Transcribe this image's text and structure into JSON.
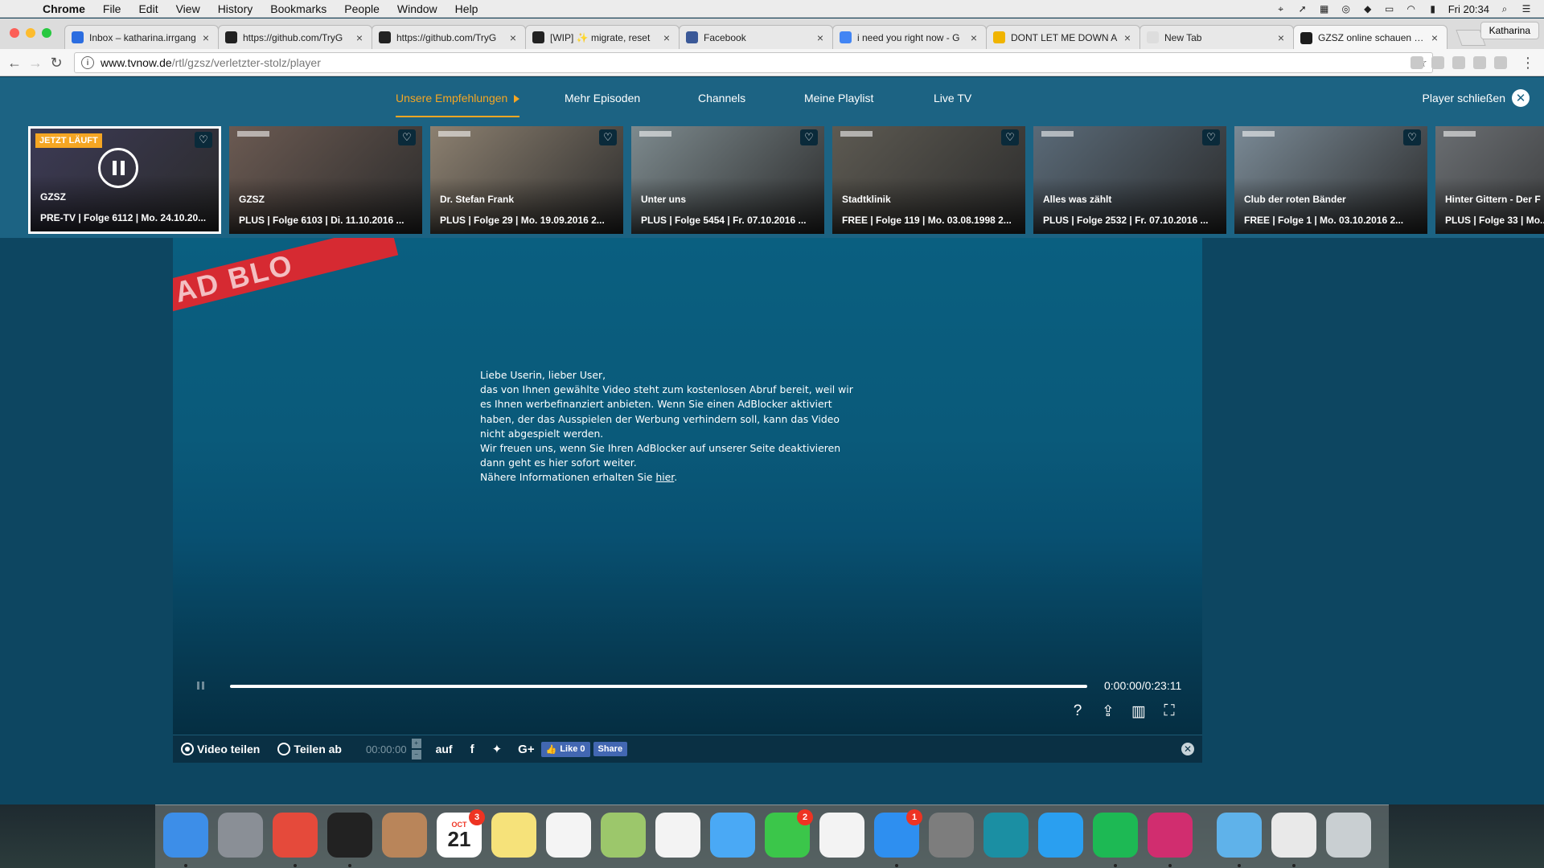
{
  "menubar": {
    "app": "Chrome",
    "items": [
      "File",
      "Edit",
      "View",
      "History",
      "Bookmarks",
      "People",
      "Window",
      "Help"
    ],
    "clock": "Fri 20:34"
  },
  "browser": {
    "tabs": [
      {
        "title": "Inbox – katharina.irrgang",
        "icon": "gmail-icon",
        "color": "#2b6de0"
      },
      {
        "title": "https://github.com/TryG",
        "icon": "github-icon",
        "color": "#222222"
      },
      {
        "title": "https://github.com/TryG",
        "icon": "github-icon",
        "color": "#222222"
      },
      {
        "title": "[WIP] ✨ migrate, reset",
        "icon": "github-icon",
        "color": "#222222"
      },
      {
        "title": "Facebook",
        "icon": "facebook-icon",
        "color": "#3b5998"
      },
      {
        "title": "i need you right now - G",
        "icon": "google-icon",
        "color": "#4285f4"
      },
      {
        "title": "DONT LET ME DOWN A",
        "icon": "extension-icon",
        "color": "#f0b400"
      },
      {
        "title": "New Tab",
        "icon": "",
        "color": "#dddddd"
      },
      {
        "title": "GZSZ online schauen als",
        "icon": "tvnow-icon",
        "color": "#1c1c1c"
      }
    ],
    "active_tab": 8,
    "profile": "Katharina",
    "url_host": "www.tvnow.de",
    "url_path": "/rtl/gzsz/verletzter-stolz/player"
  },
  "tvnav": {
    "items": [
      "Unsere Empfehlungen",
      "Mehr Episoden",
      "Channels",
      "Meine Playlist",
      "Live TV"
    ],
    "close_label": "Player schließen"
  },
  "carousel": {
    "now_playing_badge": "JETZT LÄUFT",
    "cards": [
      {
        "title": "GZSZ",
        "subtitle": "PRE-TV | Folge 6112 | Mo. 24.10.20...",
        "bg": "#3c3a55"
      },
      {
        "title": "GZSZ",
        "subtitle": "PLUS | Folge 6103 | Di. 11.10.2016 ...",
        "bg": "#6b5a52"
      },
      {
        "title": "Dr. Stefan Frank",
        "subtitle": "PLUS | Folge 29 | Mo. 19.09.2016 2...",
        "bg": "#8c8070"
      },
      {
        "title": "Unter uns",
        "subtitle": "PLUS | Folge 5454 | Fr. 07.10.2016 ...",
        "bg": "#7d8a8e"
      },
      {
        "title": "Stadtklinik",
        "subtitle": "FREE | Folge 119 | Mo. 03.08.1998 2...",
        "bg": "#5d5a52"
      },
      {
        "title": "Alles was zählt",
        "subtitle": "PLUS | Folge 2532 | Fr. 07.10.2016 ...",
        "bg": "#5a6a78"
      },
      {
        "title": "Club der roten Bänder",
        "subtitle": "FREE | Folge 1 | Mo. 03.10.2016 2...",
        "bg": "#7a8a96"
      },
      {
        "title": "Hinter Gittern - Der F",
        "subtitle": "PLUS | Folge 33 | Mo...",
        "bg": "#6a6e72"
      }
    ]
  },
  "player": {
    "ribbon_text": "AD BLO",
    "message": {
      "line1": "Liebe Userin, lieber User,",
      "line2": "das von Ihnen gewählte Video steht zum kostenlosen Abruf bereit, weil wir",
      "line3": "es Ihnen werbefinanziert anbieten. Wenn Sie einen AdBlocker aktiviert",
      "line4": "haben, der das Ausspielen der Werbung verhindern soll, kann das Video",
      "line5": "nicht abgespielt werden.",
      "line6": "Wir freuen uns, wenn Sie Ihren AdBlocker auf unserer Seite deaktivieren",
      "line7": "dann geht es hier sofort weiter.",
      "line8_prefix": "Nähere Informationen erhalten Sie ",
      "link": "hier",
      "line8_suffix": "."
    },
    "progress": 0.0,
    "timecode": "0:00:00/0:23:11",
    "icons": [
      "help-icon",
      "share-icon",
      "quality-icon",
      "fullscreen-icon"
    ]
  },
  "sharebar": {
    "option1": "Video teilen",
    "option2": "Teilen ab",
    "time": "00:00:00",
    "on_label": "auf",
    "like_label": "Like 0",
    "share_label": "Share"
  },
  "dock": {
    "apps": [
      {
        "name": "finder-icon",
        "color": "#3d8ee8"
      },
      {
        "name": "launchpad-icon",
        "color": "#8a8f96"
      },
      {
        "name": "chrome-icon",
        "color": "#e54a3b"
      },
      {
        "name": "terminal-icon",
        "color": "#222222"
      },
      {
        "name": "contacts-icon",
        "color": "#b9855a"
      },
      {
        "name": "calendar-icon",
        "color": "#ffffff"
      },
      {
        "name": "notes-icon",
        "color": "#f6e27a"
      },
      {
        "name": "reminders-icon",
        "color": "#f4f4f4"
      },
      {
        "name": "maps-icon",
        "color": "#9cc76b"
      },
      {
        "name": "photos-icon",
        "color": "#f3f3f3"
      },
      {
        "name": "messages-icon",
        "color": "#4aa9f5"
      },
      {
        "name": "facetime-icon",
        "color": "#3bc64a"
      },
      {
        "name": "itunes-icon",
        "color": "#f3f3f3"
      },
      {
        "name": "app-store-icon",
        "color": "#2e8ff0"
      },
      {
        "name": "system-preferences-icon",
        "color": "#7d7d7d"
      },
      {
        "name": "vpn-icon",
        "color": "#1b8fa3"
      },
      {
        "name": "skype-icon",
        "color": "#2a9ff0"
      },
      {
        "name": "spotify-icon",
        "color": "#1db954"
      },
      {
        "name": "intellij-icon",
        "color": "#d12d6f"
      },
      {
        "name": "folder-icon",
        "color": "#5fb2ea"
      },
      {
        "name": "preview-icon",
        "color": "#e9e9e9"
      },
      {
        "name": "trash-icon",
        "color": "#c9cfd2"
      }
    ],
    "calendar_month": "OCT",
    "calendar_day": "21",
    "badges": {
      "calendar": "3",
      "facetime": "2",
      "app_store": "1"
    }
  },
  "colors": {
    "accent": "#f5a623",
    "nav_bg": "#1c6383",
    "player_bg": "#0a5f80",
    "facebook": "#4267b2"
  }
}
